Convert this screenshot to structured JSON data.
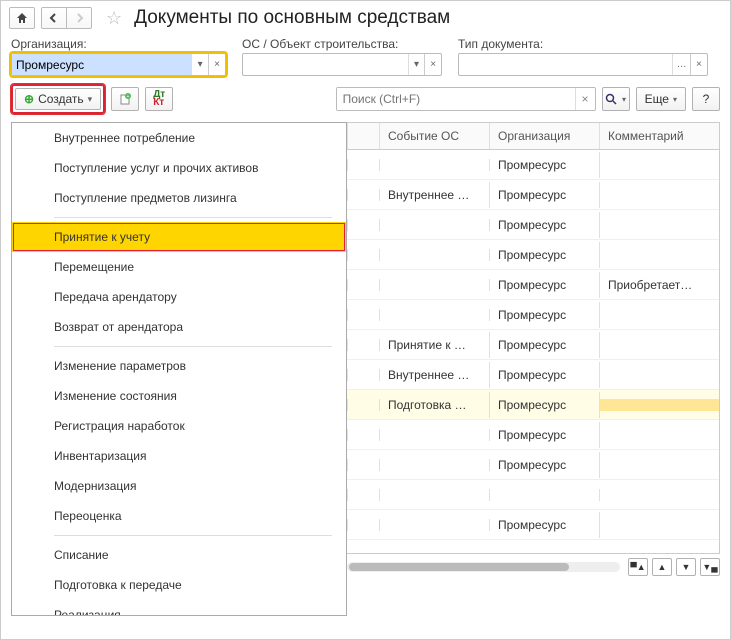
{
  "header": {
    "title": "Документы по основным средствам"
  },
  "filters": {
    "org": {
      "label": "Организация:",
      "value": "Промресурс"
    },
    "os": {
      "label": "ОС / Объект строительства:",
      "value": ""
    },
    "doctype": {
      "label": "Тип документа:",
      "value": ""
    }
  },
  "toolbar": {
    "create_label": "Создать",
    "search_placeholder": "Поиск (Ctrl+F)",
    "more_label": "Еще",
    "help_label": "?"
  },
  "create_menu": {
    "items": [
      "Внутреннее потребление",
      "Поступление услуг и прочих активов",
      "Поступление предметов лизинга",
      "Принятие к учету",
      "Перемещение",
      "Передача арендатору",
      "Возврат от арендатора",
      "Изменение параметров",
      "Изменение состояния",
      "Регистрация наработок",
      "Инвентаризация",
      "Модернизация",
      "Переоценка",
      "Списание",
      "Подготовка к передаче",
      "Реализация"
    ],
    "selected_index": 3,
    "separators_after": [
      2,
      6,
      12
    ]
  },
  "grid": {
    "columns": [
      "",
      "",
      "Событие ОС",
      "Организация",
      "Комментарий"
    ],
    "rows": [
      {
        "event": "",
        "org": "Промресурс",
        "comment": ""
      },
      {
        "event": "Внутреннее …",
        "org": "Промресурс",
        "comment": ""
      },
      {
        "event": "",
        "org": "Промресурс",
        "comment": ""
      },
      {
        "event": "",
        "org": "Промресурс",
        "comment": ""
      },
      {
        "event": "",
        "org": "Промресурс",
        "comment": "Приобретает…"
      },
      {
        "event": "",
        "org": "Промресурс",
        "comment": ""
      },
      {
        "event": "Принятие к …",
        "org": "Промресурс",
        "comment": ""
      },
      {
        "event": "Внутреннее …",
        "org": "Промресурс",
        "comment": ""
      },
      {
        "event": "Подготовка …",
        "org": "Промресурс",
        "comment": "",
        "highlight": true
      },
      {
        "event": "",
        "org": "Промресурс",
        "comment": ""
      },
      {
        "event": "",
        "org": "Промресурс",
        "comment": ""
      },
      {
        "event": "",
        "org": "",
        "comment": ""
      },
      {
        "event": "",
        "org": "Промресурс",
        "comment": ""
      }
    ]
  }
}
